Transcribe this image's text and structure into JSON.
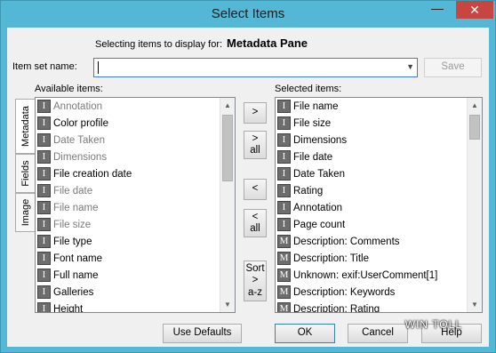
{
  "window": {
    "title": "Select Items",
    "minimize_glyph": "—",
    "close_glyph": "✕"
  },
  "header": {
    "prefix": "Selecting items to display for:",
    "target": "Metadata Pane"
  },
  "item_set": {
    "label": "Item set name:",
    "value": "",
    "save_label": "Save"
  },
  "tabs": [
    "Metadata",
    "Fields",
    "Image"
  ],
  "available": {
    "label": "Available items:",
    "items": [
      {
        "icon": "I",
        "text": "Annotation",
        "dim": true
      },
      {
        "icon": "I",
        "text": "Color profile",
        "dim": false
      },
      {
        "icon": "I",
        "text": "Date Taken",
        "dim": true
      },
      {
        "icon": "I",
        "text": "Dimensions",
        "dim": true
      },
      {
        "icon": "I",
        "text": "File creation date",
        "dim": false
      },
      {
        "icon": "I",
        "text": "File date",
        "dim": true
      },
      {
        "icon": "I",
        "text": "File name",
        "dim": true
      },
      {
        "icon": "I",
        "text": "File size",
        "dim": true
      },
      {
        "icon": "I",
        "text": "File type",
        "dim": false
      },
      {
        "icon": "I",
        "text": "Font name",
        "dim": false
      },
      {
        "icon": "I",
        "text": "Full name",
        "dim": false
      },
      {
        "icon": "I",
        "text": "Galleries",
        "dim": false
      },
      {
        "icon": "I",
        "text": "Height",
        "dim": false
      }
    ]
  },
  "selected": {
    "label": "Selected items:",
    "items": [
      {
        "icon": "I",
        "text": "File name"
      },
      {
        "icon": "I",
        "text": "File size"
      },
      {
        "icon": "I",
        "text": "Dimensions"
      },
      {
        "icon": "I",
        "text": "File date"
      },
      {
        "icon": "I",
        "text": "Date Taken"
      },
      {
        "icon": "I",
        "text": "Rating"
      },
      {
        "icon": "I",
        "text": "Annotation"
      },
      {
        "icon": "I",
        "text": "Page count"
      },
      {
        "icon": "M",
        "text": "Description: Comments"
      },
      {
        "icon": "M",
        "text": "Description: Title"
      },
      {
        "icon": "M",
        "text": "Unknown: exif:UserComment[1]"
      },
      {
        "icon": "M",
        "text": "Description: Keywords"
      },
      {
        "icon": "M",
        "text": "Description: Rating"
      }
    ]
  },
  "middle_buttons": {
    "add": ">",
    "add_all": ">\nall",
    "remove": "<",
    "remove_all": "<\nall",
    "sort": "Sort\n>\na-z"
  },
  "footer": {
    "use_defaults": "Use Defaults",
    "ok": "OK",
    "cancel": "Cancel",
    "help": "Help"
  },
  "watermark": "WIN TOLL"
}
